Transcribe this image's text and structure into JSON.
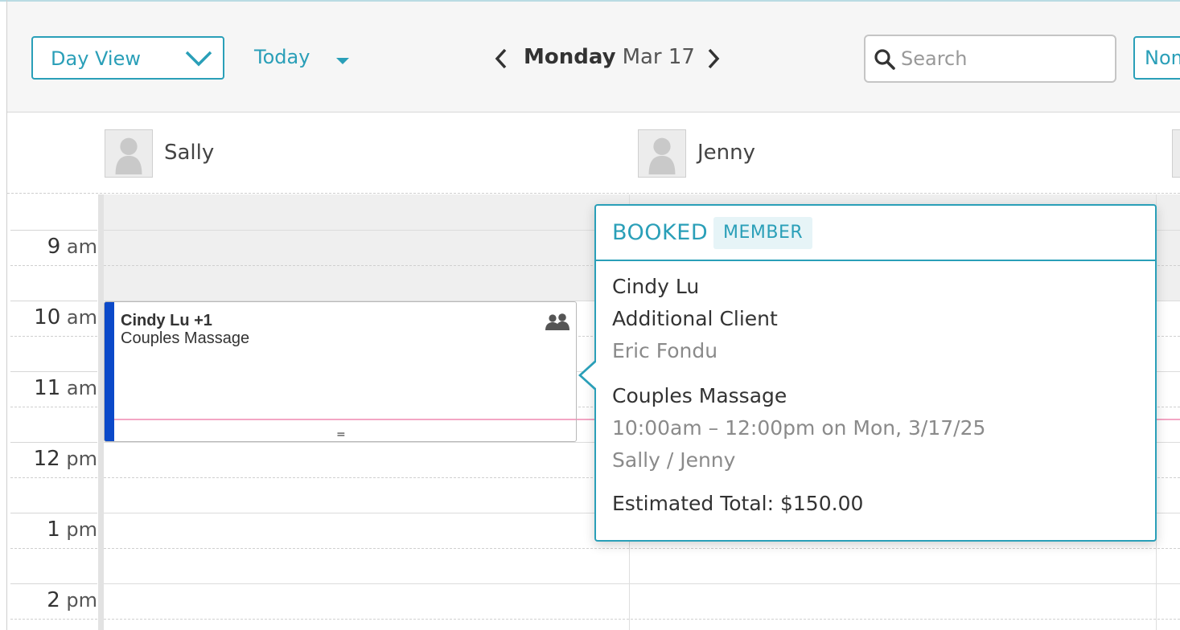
{
  "toolbar": {
    "view_select": {
      "label": "Day View",
      "icon": "chevron-down-icon"
    },
    "today_label": "Today",
    "date": {
      "day_of_week": "Monday",
      "month_day": "Mar 17"
    },
    "search": {
      "placeholder": "Search",
      "value": ""
    },
    "right_button_label": "Nom"
  },
  "staff": [
    {
      "name": "Sally"
    },
    {
      "name": "Jenny"
    }
  ],
  "time_labels": [
    {
      "hour": "9",
      "suffix": "am"
    },
    {
      "hour": "10",
      "suffix": "am"
    },
    {
      "hour": "11",
      "suffix": "am"
    },
    {
      "hour": "12",
      "suffix": "pm"
    },
    {
      "hour": "1",
      "suffix": "pm"
    },
    {
      "hour": "2",
      "suffix": "pm"
    }
  ],
  "appointment": {
    "client": "Cindy Lu +1",
    "service": "Couples Massage",
    "handle": "=",
    "accent_color": "#0b49c9"
  },
  "popover": {
    "status": "BOOKED",
    "badge": "MEMBER",
    "client_name": "Cindy Lu",
    "additional_label": "Additional Client",
    "additional_name": "Eric Fondu",
    "service": "Couples Massage",
    "time": "10:00am – 12:00pm on Mon, 3/17/25",
    "staff": "Sally / Jenny",
    "total": "Estimated Total: $150.00"
  },
  "colors": {
    "accent": "#2a9fb8",
    "appointment_bar": "#0b49c9",
    "current_time_line": "#f3a6c4"
  }
}
